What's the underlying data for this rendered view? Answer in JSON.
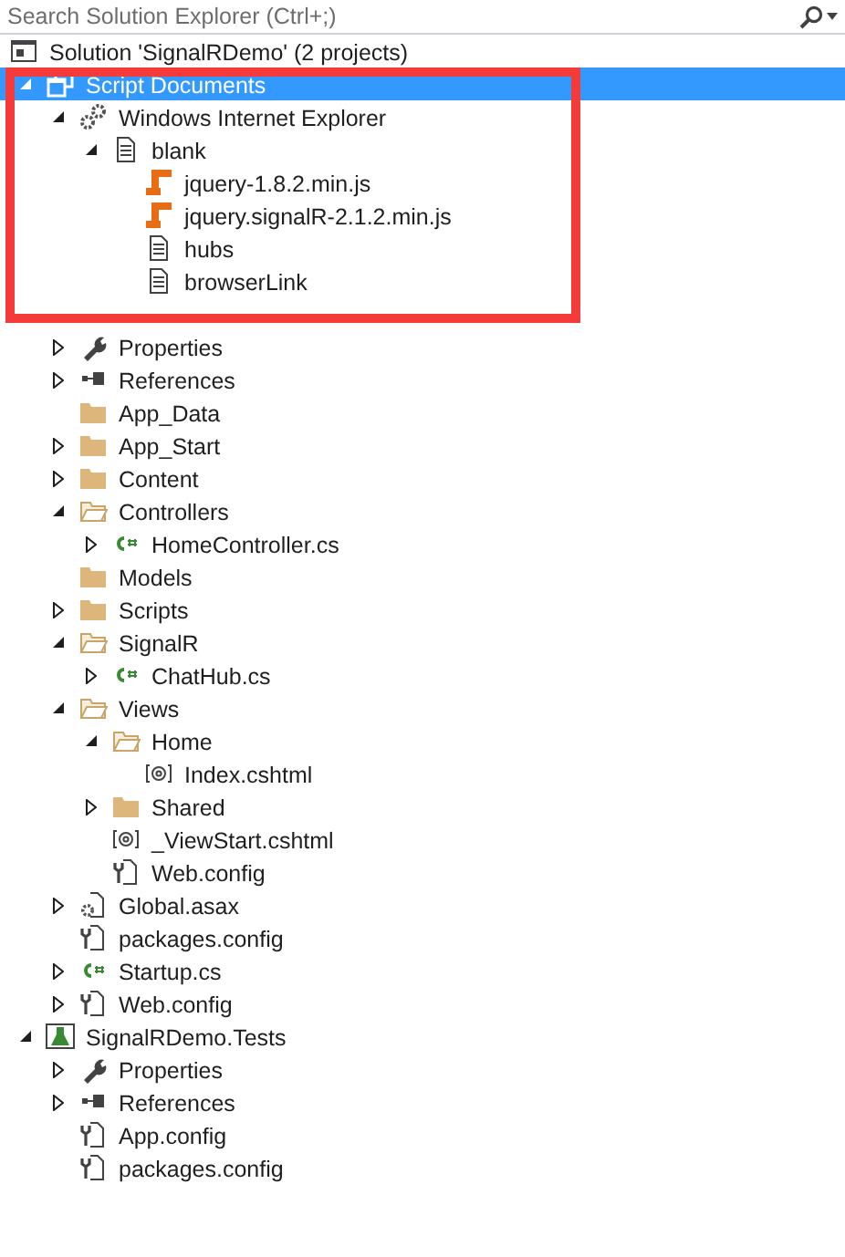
{
  "search": {
    "placeholder": "Search Solution Explorer (Ctrl+;)"
  },
  "tree": [
    {
      "kind": "solution",
      "label": "Solution 'SignalRDemo' (2 projects)",
      "selected": false,
      "children": [
        {
          "kind": "script-documents",
          "label": "Script Documents",
          "selected": true,
          "expanded": true,
          "children": [
            {
              "kind": "process",
              "label": "Windows Internet Explorer",
              "selected": false,
              "expanded": true,
              "children": [
                {
                  "kind": "page",
                  "label": "blank",
                  "selected": false,
                  "expanded": true,
                  "children": [
                    {
                      "kind": "script",
                      "label": "jquery-1.8.2.min.js",
                      "selected": false
                    },
                    {
                      "kind": "script",
                      "label": "jquery.signalR-2.1.2.min.js",
                      "selected": false
                    },
                    {
                      "kind": "page",
                      "label": "hubs",
                      "selected": false
                    },
                    {
                      "kind": "page",
                      "label": "browserLink",
                      "selected": false
                    }
                  ]
                }
              ]
            }
          ]
        },
        {
          "children": [
            {
              "kind": "wrench",
              "label": "Properties",
              "selected": false,
              "expanded": false
            },
            {
              "kind": "references",
              "label": "References",
              "selected": false,
              "expanded": false
            },
            {
              "kind": "folder",
              "label": "App_Data",
              "selected": false
            },
            {
              "kind": "folder",
              "label": "App_Start",
              "selected": false,
              "expanded": false
            },
            {
              "kind": "folder",
              "label": "Content",
              "selected": false,
              "expanded": false
            },
            {
              "kind": "folder-open",
              "label": "Controllers",
              "selected": false,
              "expanded": true,
              "children": [
                {
                  "kind": "csharp",
                  "label": "HomeController.cs",
                  "selected": false,
                  "expanded": false
                }
              ]
            },
            {
              "kind": "folder",
              "label": "Models",
              "selected": false
            },
            {
              "kind": "folder",
              "label": "Scripts",
              "selected": false,
              "expanded": false
            },
            {
              "kind": "folder-open",
              "label": "SignalR",
              "selected": false,
              "expanded": true,
              "children": [
                {
                  "kind": "csharp",
                  "label": "ChatHub.cs",
                  "selected": false,
                  "expanded": false
                }
              ]
            },
            {
              "kind": "folder-open",
              "label": "Views",
              "selected": false,
              "expanded": true,
              "children": [
                {
                  "kind": "folder-open",
                  "label": "Home",
                  "selected": false,
                  "expanded": true,
                  "children": [
                    {
                      "kind": "razor",
                      "label": "Index.cshtml",
                      "selected": false
                    }
                  ]
                },
                {
                  "kind": "folder",
                  "label": "Shared",
                  "selected": false,
                  "expanded": false
                },
                {
                  "kind": "razor",
                  "label": "_ViewStart.cshtml",
                  "selected": false
                },
                {
                  "kind": "config",
                  "label": "Web.config",
                  "selected": false
                }
              ]
            },
            {
              "kind": "asax",
              "label": "Global.asax",
              "selected": false,
              "expanded": false
            },
            {
              "kind": "config",
              "label": "packages.config",
              "selected": false
            },
            {
              "kind": "csharp",
              "label": "Startup.cs",
              "selected": false,
              "expanded": false
            },
            {
              "kind": "config",
              "label": "Web.config",
              "selected": false,
              "expanded": false
            }
          ]
        },
        {
          "kind": "test-project",
          "label": "SignalRDemo.Tests",
          "selected": false,
          "expanded": true,
          "children": [
            {
              "kind": "wrench",
              "label": "Properties",
              "selected": false,
              "expanded": false
            },
            {
              "kind": "references",
              "label": "References",
              "selected": false,
              "expanded": false
            },
            {
              "kind": "config",
              "label": "App.config",
              "selected": false
            },
            {
              "kind": "config",
              "label": "packages.config",
              "selected": false
            }
          ]
        }
      ]
    }
  ]
}
